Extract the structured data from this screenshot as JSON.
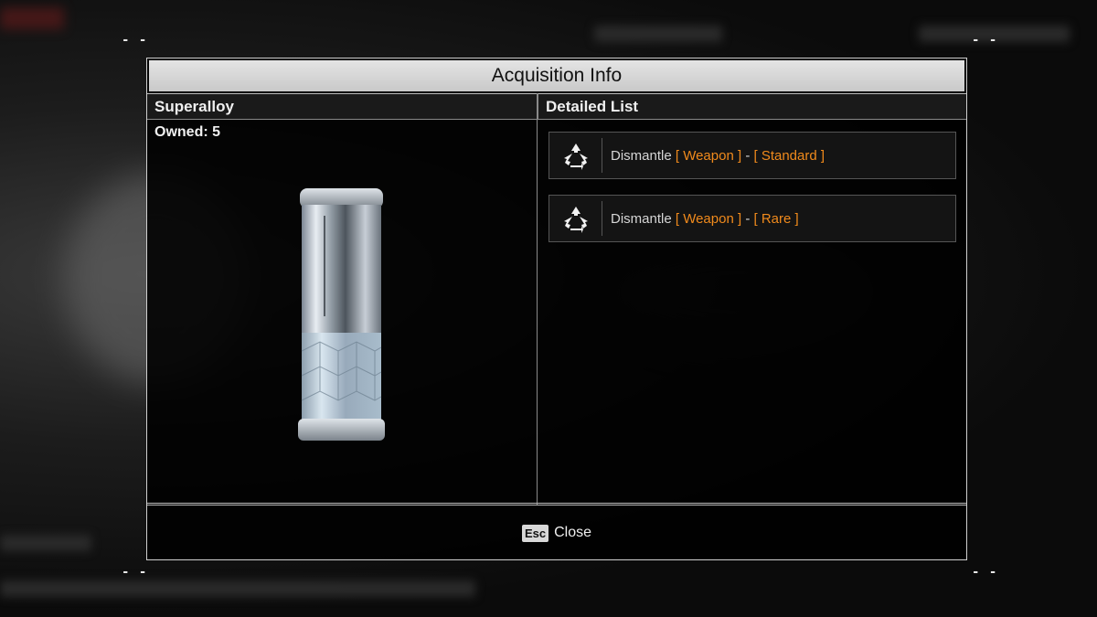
{
  "modal": {
    "title": "Acquisition Info"
  },
  "left_panel": {
    "header": "Superalloy",
    "owned": "Owned: 5"
  },
  "right_panel": {
    "header": "Detailed List",
    "sources": [
      {
        "prefix": "Dismantle",
        "category": "[ Weapon ]",
        "separator": "-",
        "rarity": "[ Standard ]",
        "icon": "recycle-icon"
      },
      {
        "prefix": "Dismantle",
        "category": "[ Weapon ]",
        "separator": "-",
        "rarity": "[ Rare ]",
        "icon": "recycle-icon"
      }
    ]
  },
  "footer": {
    "key": "Esc",
    "label": "Close"
  },
  "corners": "- -",
  "colors": {
    "accent": "#f08a1c",
    "title_bar": "#d4d4d4",
    "border": "#cfcfcf"
  }
}
